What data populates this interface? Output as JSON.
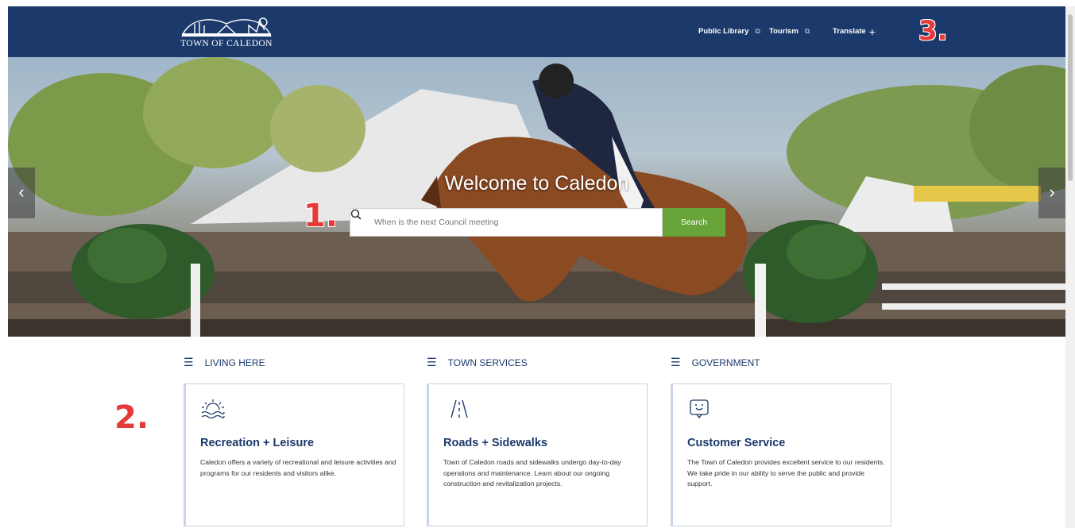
{
  "header": {
    "logo_text": "TOWN OF CALEDON",
    "links": [
      {
        "label": "Public Library",
        "icon": "external-link-icon"
      },
      {
        "label": "Tourism",
        "icon": "external-link-icon"
      }
    ],
    "translate_label": "Translate",
    "annotation": "3."
  },
  "hero": {
    "title": "Welcome to Caledon",
    "search_placeholder": "When is the next Council meeting",
    "search_button": "Search",
    "annotation": "1.",
    "prev_arrow": "‹",
    "next_arrow": "›"
  },
  "categories": {
    "annotation": "2.",
    "columns": [
      {
        "heading": "LIVING HERE",
        "card_icon": "sun-wave-icon",
        "title": "Recreation + Leisure",
        "description": "Caledon offers a variety of recreational and leisure activities and programs for our residents and visitors alike."
      },
      {
        "heading": "TOWN SERVICES",
        "card_icon": "road-icon",
        "title": "Roads + Sidewalks",
        "description": "Town of Caledon roads and sidewalks undergo day-to-day operations and maintenance. Learn about our ongoing construction and revitalization projects."
      },
      {
        "heading": "GOVERNMENT",
        "card_icon": "chat-smile-icon",
        "title": "Customer Service",
        "description": "The Town of Caledon provides excellent service to our residents. We take pride in our ability to serve the public and provide support."
      }
    ]
  },
  "colors": {
    "navy": "#1b3a6b",
    "green": "#67a43a",
    "annotation_red": "#e63939"
  }
}
